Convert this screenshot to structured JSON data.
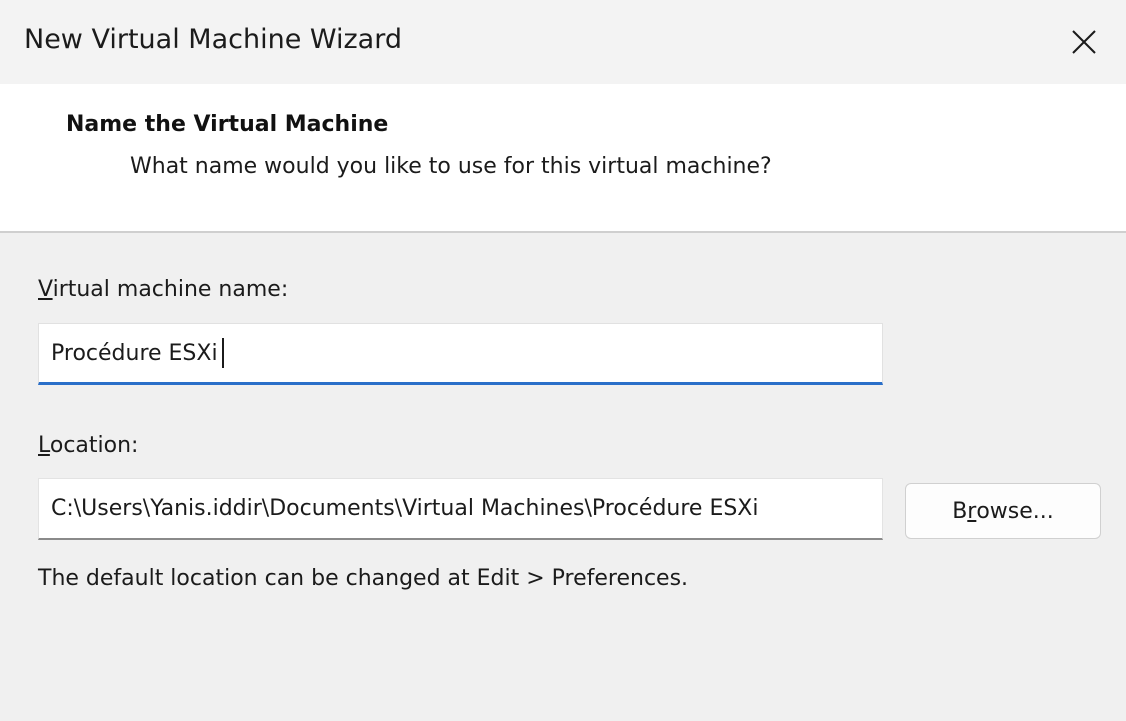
{
  "window": {
    "title": "New Virtual Machine Wizard"
  },
  "header": {
    "title": "Name the Virtual Machine",
    "subtitle": "What name would you like to use for this virtual machine?"
  },
  "form": {
    "name_label_accel": "V",
    "name_label_rest": "irtual machine name:",
    "name_value": "Procédure ESXi",
    "location_label_accel": "L",
    "location_label_rest": "ocation:",
    "location_value": "C:\\Users\\Yanis.iddir\\Documents\\Virtual Machines\\Procédure ESXi",
    "browse_label_pre": "B",
    "browse_label_accel": "r",
    "browse_label_post": "owse...",
    "hint": "The default location can be changed at Edit > Preferences."
  },
  "colors": {
    "accent": "#2a6fc9",
    "titlebar_bg": "#f3f3f3",
    "content_bg": "#f0f0f0"
  },
  "icons": {
    "close": "close-icon"
  }
}
